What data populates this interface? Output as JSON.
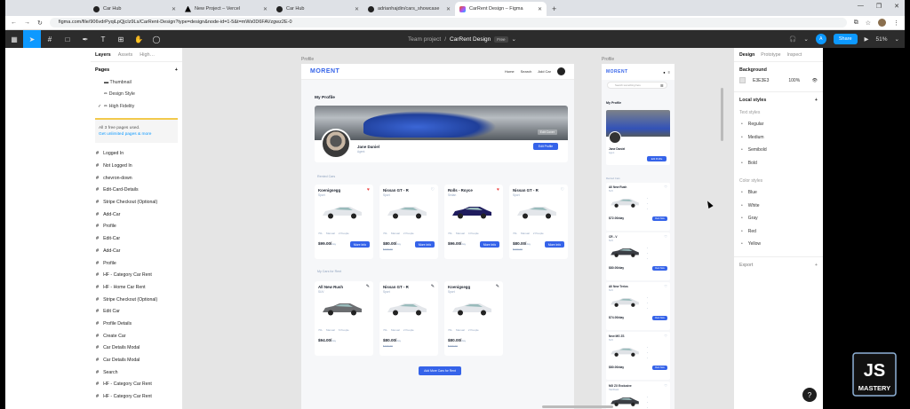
{
  "browser": {
    "tabs": [
      {
        "label": "Car Hub",
        "icon": "github-icon",
        "active": false
      },
      {
        "label": "New Project – Vercel",
        "icon": "vercel-icon",
        "active": false
      },
      {
        "label": "Car Hub",
        "icon": "github-icon",
        "active": false
      },
      {
        "label": "adrianhajdin/cars_showcase",
        "icon": "github-icon",
        "active": false
      },
      {
        "label": "CarRent Design – Figma",
        "icon": "figma-icon",
        "active": true
      }
    ],
    "new_tab": "+",
    "url": "figma.com/file/906vdrPyqiLpQjcIz9Ls/CarRent-Design?type=design&node-id=1-5&t=mWs0D6FAVzgwz2E-0"
  },
  "figma": {
    "team": "Team project",
    "separator": "/",
    "document": "CarRent Design",
    "plan_badge": "Free",
    "avatar_initial": "A",
    "share_label": "Share",
    "zoom": "51%"
  },
  "left_panel": {
    "tabs": [
      "Layers",
      "Assets",
      "High…"
    ],
    "pages_title": "Pages",
    "add": "+",
    "pages": [
      {
        "label": "▬ Thumbnail",
        "checked": false
      },
      {
        "label": "✏ Design Style",
        "checked": false
      },
      {
        "label": "✏ High Fidelity",
        "checked": true
      }
    ],
    "upsell_text": "All 3 free pages used.",
    "upsell_link": "Get unlimited pages & more",
    "layers": [
      "Logged In",
      "Not Logged In",
      "chevron-down",
      "Edit-Card-Details",
      "Stripe Checkout (Optional)",
      "Add-Car",
      "Profile",
      "Edit-Car",
      "Add-Car",
      "Profile",
      "HF - Category Car Rent",
      "HF - Home Car Rent",
      "Stripe Checkout (Optional)",
      "Edit Car",
      "Profile Details",
      "Create Car",
      "Car Details Modal",
      "Car Details Modal",
      "Search",
      "HF - Category Car Rent",
      "HF - Category Car Rent"
    ]
  },
  "canvas": {
    "frame_label_desktop": "Profile",
    "frame_label_mobile": "Profile",
    "desktop": {
      "logo": "MORENT",
      "nav": [
        "Home",
        "Search",
        "Add Car"
      ],
      "section_title": "My Profile",
      "edit_cover": "Edit Cover",
      "user_name": "Jane Daniel",
      "user_role": "Agent",
      "edit_profile": "Edit Profile",
      "rented_title": "Rented Cars",
      "rented": [
        {
          "name": "Koenigsegg",
          "type": "Sport",
          "fav": true,
          "price": "$99.00/",
          "unit": "day",
          "old": "",
          "btn": "More Info",
          "specs": [
            "70L",
            "Manual",
            "2 People"
          ]
        },
        {
          "name": "Nissan GT - R",
          "type": "Sport",
          "fav": false,
          "price": "$80.00/",
          "unit": "day",
          "old": "$100.00",
          "btn": "More Info",
          "specs": [
            "70L",
            "Manual",
            "2 People"
          ]
        },
        {
          "name": "Rolls - Royce",
          "type": "Sedan",
          "fav": true,
          "price": "$96.00/",
          "unit": "day",
          "old": "",
          "btn": "More Info",
          "specs": [
            "70L",
            "Manual",
            "4 People"
          ]
        },
        {
          "name": "Nissan GT - R",
          "type": "Sport",
          "fav": false,
          "price": "$80.00/",
          "unit": "day",
          "old": "$100.00",
          "btn": "More Info",
          "specs": [
            "70L",
            "Manual",
            "2 People"
          ]
        }
      ],
      "mine_title": "My Cars for Rent",
      "mine": [
        {
          "name": "All New Rush",
          "type": "SUV",
          "price": "$94.00/",
          "unit": "day",
          "old": "",
          "specs": [
            "70L",
            "Manual",
            "6 People"
          ]
        },
        {
          "name": "Nissan GT - R",
          "type": "Sport",
          "price": "$80.00/",
          "unit": "day",
          "old": "$100.00",
          "specs": [
            "70L",
            "Manual",
            "2 People"
          ]
        },
        {
          "name": "Koenigsegg",
          "type": "Sport",
          "price": "$80.00/",
          "unit": "day",
          "old": "$100.00",
          "specs": [
            "70L",
            "Manual",
            "2 People"
          ]
        }
      ],
      "add_more": "Add More Cars for Rent"
    },
    "mobile": {
      "logo": "MORENT",
      "search_placeholder": "Search something here",
      "section_title": "My Profile",
      "user_name": "Jane Daniel",
      "user_role": "Agent",
      "edit_profile": "Edit Profile",
      "rented_title": "Rented Cars",
      "cards": [
        {
          "name": "All New Rush",
          "type": "SUV",
          "price": "$72.00/day",
          "btn": "Rent Now"
        },
        {
          "name": "CR - V",
          "type": "SUV",
          "price": "$80.00/day",
          "btn": "Rent Now"
        },
        {
          "name": "All New Terios",
          "type": "SUV",
          "price": "$74.00/day",
          "btn": "Rent Now"
        },
        {
          "name": "New MG ZS",
          "type": "SUV",
          "price": "$80.00/day",
          "btn": "Rent Now"
        },
        {
          "name": "MG ZX Exclusive",
          "type": "Hatchback",
          "price": "",
          "btn": ""
        }
      ]
    }
  },
  "right_panel": {
    "tabs": [
      "Design",
      "Prototype",
      "Inspect"
    ],
    "background_title": "Background",
    "bg_hex": "E3E3E3",
    "bg_opacity": "100%",
    "local_styles": "Local styles",
    "text_styles_title": "Text styles",
    "text_styles": [
      "Regular",
      "Medium",
      "Semibold",
      "Bold"
    ],
    "color_styles_title": "Color styles",
    "color_styles": [
      "Blue",
      "White",
      "Gray",
      "Red",
      "Yellow"
    ],
    "export_title": "Export",
    "plus": "+"
  },
  "overlay": {
    "logo_top": "JS",
    "logo_bottom": "MASTERY",
    "help": "?"
  },
  "colors": {
    "accent": "#3563e9",
    "figma_blue": "#0d99ff",
    "heart": "#ed3f3f"
  }
}
